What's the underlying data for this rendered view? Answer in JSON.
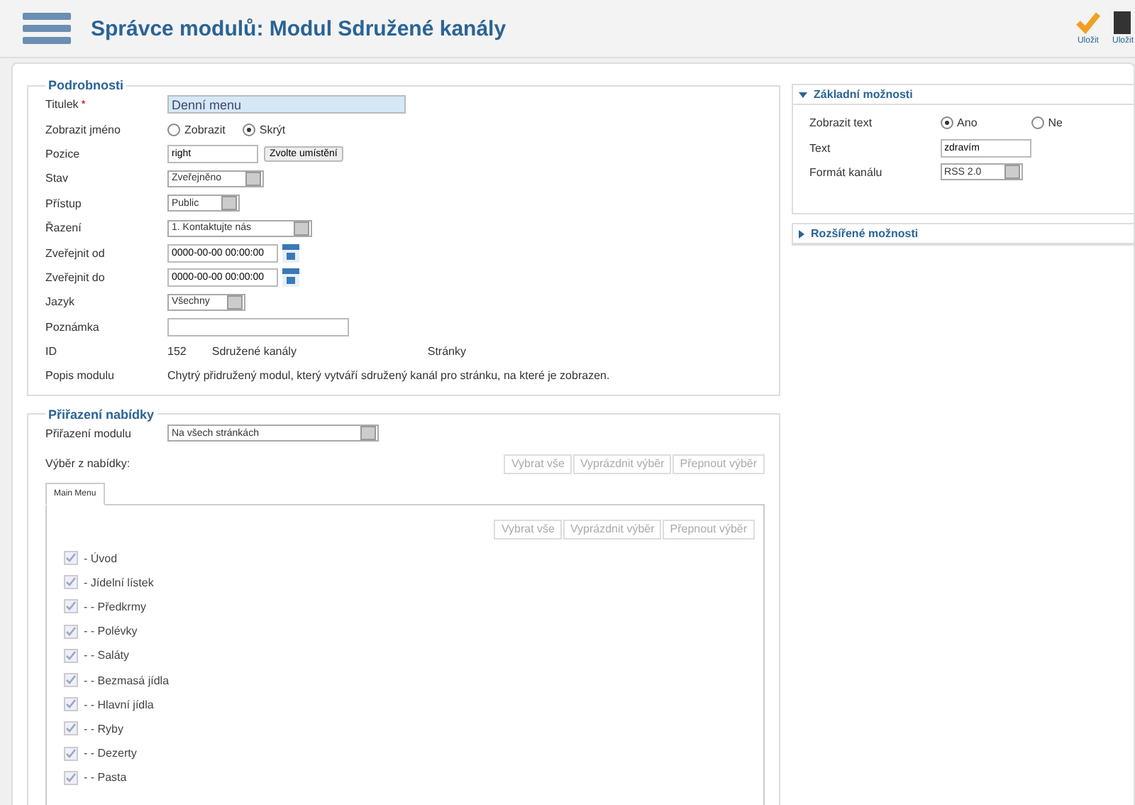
{
  "header": {
    "title": "Správce modulů: Modul Sdružené kanály",
    "toolbar": [
      {
        "label": "Uložit",
        "kind": "check"
      },
      {
        "label": "Uložit",
        "kind": "dark"
      }
    ]
  },
  "details": {
    "legend": "Podrobnosti",
    "fields": [
      {
        "kind": "text",
        "label": "Titulek",
        "required_mark": "*",
        "value": "Denní menu",
        "highlight": true
      },
      {
        "kind": "radio",
        "label": "Zobrazit jméno",
        "options": [
          {
            "label": "Zobrazit",
            "selected": false
          },
          {
            "label": "Skrýt",
            "selected": true
          }
        ]
      },
      {
        "kind": "position",
        "label": "Pozice",
        "value": "right",
        "button": "Zvolte umístění"
      },
      {
        "kind": "select",
        "label": "Stav",
        "value": "Zveřejněno"
      },
      {
        "kind": "select",
        "label": "Přístup",
        "value": "Public"
      },
      {
        "kind": "select",
        "label": "Řazení",
        "value": "1. Kontaktujte nás"
      },
      {
        "kind": "date",
        "label": "Zveřejnit od",
        "value": "0000-00-00 00:00:00"
      },
      {
        "kind": "date",
        "label": "Zveřejnit do",
        "value": "0000-00-00 00:00:00"
      },
      {
        "kind": "select",
        "label": "Jazyk",
        "value": "Všechny"
      },
      {
        "kind": "text",
        "label": "Poznámka",
        "highlight": false
      },
      {
        "kind": "info",
        "label": "ID",
        "parts": [
          "152",
          "Sdružené kanály",
          "Stránky"
        ]
      },
      {
        "kind": "desc",
        "label": "Popis modulu",
        "value": "Chytrý přidružený modul, který vytváří sdružený kanál pro stránku, na které je zobrazen."
      }
    ]
  },
  "assignment": {
    "legend": "Přiřazení nabídky",
    "module_label": "Přiřazení modulu",
    "module_value": "Na všech stránkách",
    "menu_label": "Výběr z nabídky:",
    "buttons": [
      "Vybrat vše",
      "Vyprázdnit výběr",
      "Přepnout výběr"
    ],
    "tabs": [
      {
        "label": "Main Menu",
        "selected": true
      }
    ],
    "inner_buttons": [
      "Vybrat vše",
      "Vyprázdnit výběr",
      "Přepnout výběr"
    ],
    "items": [
      {
        "label": "- Úvod",
        "checked": true
      },
      {
        "label": "- Jídelní lístek",
        "checked": true
      },
      {
        "label": "- - Předkrmy",
        "checked": true
      },
      {
        "label": "- - Polévky",
        "checked": true
      },
      {
        "label": "- - Saláty",
        "checked": true
      },
      {
        "label": "- - Bezmasá jídla",
        "checked": true
      },
      {
        "label": "- - Hlavní jídla",
        "checked": true
      },
      {
        "label": "- - Ryby",
        "checked": true
      },
      {
        "label": "- - Dezerty",
        "checked": true
      },
      {
        "label": "- - Pasta",
        "checked": true
      }
    ]
  },
  "options": [
    {
      "title": "Základní možnosti",
      "expanded": true,
      "fields": [
        {
          "kind": "radio",
          "label": "Zobrazit text",
          "options": [
            {
              "label": "Ano",
              "selected": true
            },
            {
              "label": "Ne",
              "selected": false
            }
          ]
        },
        {
          "kind": "text",
          "label": "Text",
          "value": "zdravím"
        },
        {
          "kind": "select",
          "label": "Formát kanálu",
          "value": "RSS 2.0"
        }
      ]
    },
    {
      "title": "Rozšířené možnosti",
      "expanded": false
    }
  ]
}
